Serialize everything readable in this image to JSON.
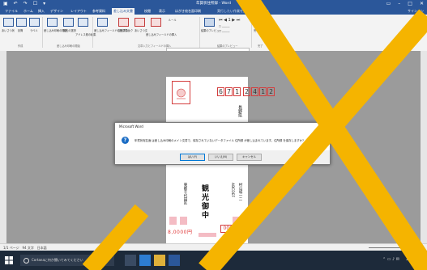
{
  "window": {
    "title": "年賀状住所録 - Word",
    "account": "サインイン",
    "qat_icons": [
      "save-icon",
      "undo-icon",
      "redo-icon",
      "touch-icon",
      "more-icon"
    ]
  },
  "tabs": [
    "ファイル",
    "ホーム",
    "挿入",
    "デザイン",
    "レイアウト",
    "参考資料",
    "差し込み文書",
    "校閲",
    "表示",
    "はがき宛名面印刷"
  ],
  "active_tab": "差し込み文書",
  "tell_me": "実行したい作業を入力してください",
  "ribbon": {
    "buttons": [
      "あいさつ状",
      "封筒",
      "ラベル",
      "差し込み印刷の開始",
      "宛先の選択",
      "アドレス帳の編集",
      "差し込みフィールドの強調表示",
      "住所ブロック",
      "あいさつ文",
      "差し込みフィールドの挿入",
      "ルール",
      "結果のプレビュー",
      "完了と差し込み"
    ],
    "group_create": "作成",
    "group_start": "差し込み印刷の開始",
    "group_fields": "文章入力とフィールドの挿入",
    "group_preview": "結果のプレビュー",
    "group_finish": "完了"
  },
  "card": {
    "postal_code": [
      "6",
      "7",
      "1",
      "2",
      "4",
      "1",
      "2"
    ],
    "recipient": "観光御中",
    "address_col1": "長野県",
    "sender_col": "東都千代田区",
    "sender_col2": "ABCDEF",
    "sender_col3": "村山城一二",
    "price": "8,0000円",
    "sender_postal": "000000"
  },
  "dialog": {
    "title": "Microsoft Word",
    "message": "年賀状宛名面 は差し込み印刷のメイン文書で、保存されていないデータファイル 住所録 が差し込まれています。住所録 を保存しますか?",
    "buttons": [
      "はい(Y)",
      "いいえ(N)",
      "キャンセル"
    ]
  },
  "status": {
    "page": "1/1 ページ",
    "words": "94 文字",
    "language": "日本語",
    "zoom": "100%"
  },
  "taskbar": {
    "search_placeholder": "Cortanaに何か聞いてみてください",
    "time": "21:46",
    "date": "2016/09/..."
  },
  "colors": {
    "word_blue": "#2b579a",
    "stamp_red": "#d43d3d",
    "overlay_yellow": "#f5b400"
  }
}
